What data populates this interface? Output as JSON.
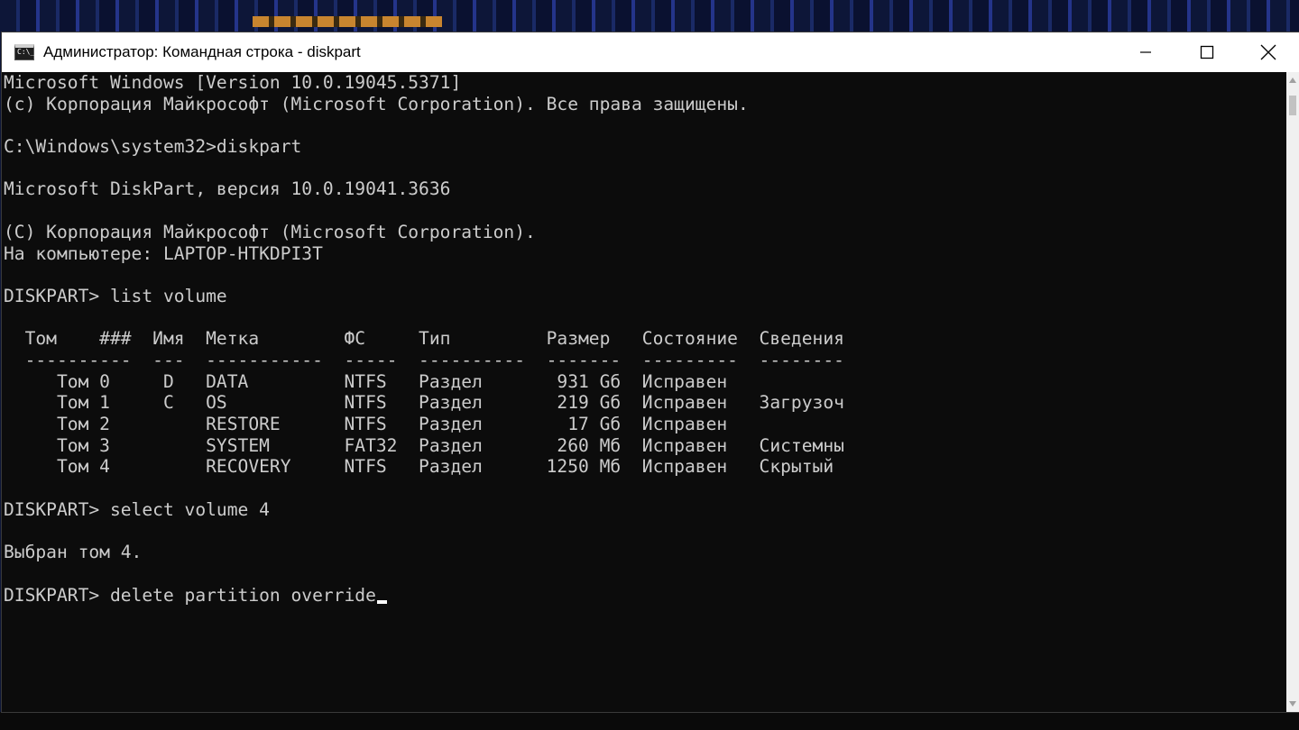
{
  "window": {
    "title": "Администратор: Командная строка - diskpart",
    "icon": "cmd-icon",
    "icon_text": "C:\\_"
  },
  "controls": {
    "minimize": "minimize-icon",
    "maximize": "maximize-icon",
    "close": "close-icon"
  },
  "console": {
    "lines": [
      "Microsoft Windows [Version 10.0.19045.5371]",
      "(c) Корпорация Майкрософт (Microsoft Corporation). Все права защищены.",
      "",
      "C:\\Windows\\system32>diskpart",
      "",
      "Microsoft DiskPart, версия 10.0.19041.3636",
      "",
      "(C) Корпорация Майкрософт (Microsoft Corporation).",
      "На компьютере: LAPTOP-HTKDPI3T",
      "",
      "DISKPART> list volume",
      "",
      "  Том    ###  Имя  Метка        ФС     Тип         Размер   Состояние  Сведения",
      "  ----------  ---  -----------  -----  ----------  -------  ---------  --------",
      "     Том 0     D   DATA         NTFS   Раздел       931 Gб  Исправен",
      "     Том 1     C   OS           NTFS   Раздел       219 Gб  Исправен   Загрузоч",
      "     Том 2         RESTORE      NTFS   Раздел        17 Gб  Исправен",
      "     Том 3         SYSTEM       FAT32  Раздел       260 Мб  Исправен   Системны",
      "     Том 4         RECOVERY     NTFS   Раздел      1250 Мб  Исправен   Скрытый",
      "",
      "DISKPART> select volume 4",
      "",
      "Выбран том 4.",
      ""
    ],
    "current_command": "DISKPART> delete partition override"
  },
  "colors": {
    "console_bg": "#0c0c0c",
    "console_text": "#cccccc",
    "titlebar_bg": "#ffffff"
  }
}
